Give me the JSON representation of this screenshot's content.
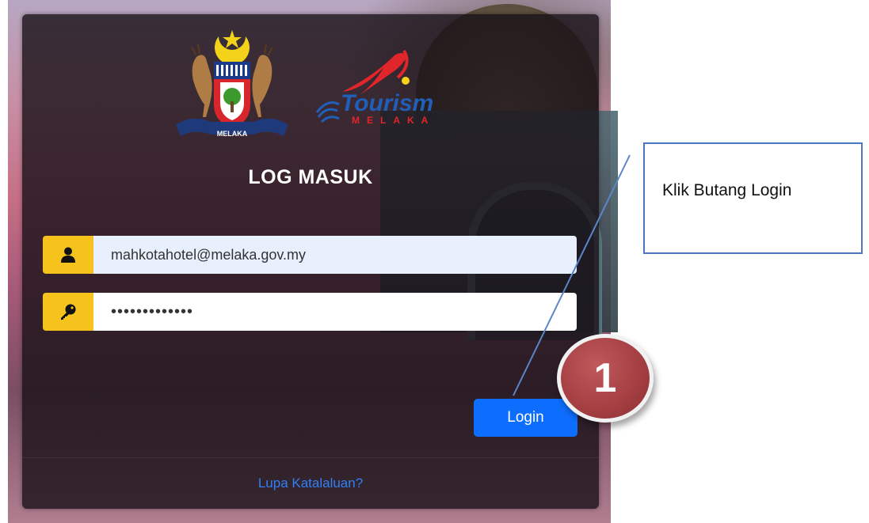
{
  "login": {
    "title": "LOG MASUK",
    "username_value": "mahkotahotel@melaka.gov.my",
    "password_value": "•••••••••••••",
    "login_label": "Login",
    "forgot_label": "Lupa Katalaluan?"
  },
  "logos": {
    "crest": "melaka-state-crest",
    "tourism_text": "Tourism",
    "tourism_sub": "MELAKA"
  },
  "annotation": {
    "callout_text": "Klik Butang Login",
    "step_number": "1"
  },
  "icons": {
    "username": "user-icon",
    "password": "key-icon"
  },
  "colors": {
    "addon": "#f6c21c",
    "primary": "#0d6efd",
    "link": "#2f80f5",
    "badge": "#a43e41",
    "callout_border": "#4c77c0"
  }
}
